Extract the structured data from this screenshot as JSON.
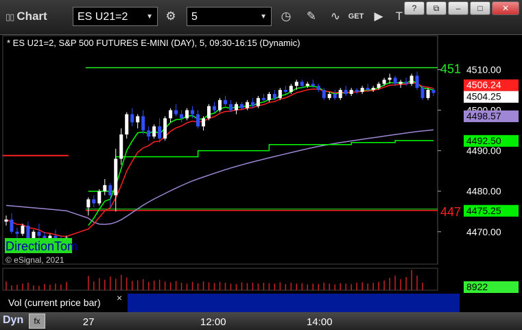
{
  "toolbar": {
    "title": "Chart",
    "symbol": "ES U21=2",
    "interval": "5",
    "window_controls": [
      "?",
      "⧉",
      "–",
      "□",
      "✕"
    ]
  },
  "chart_header": "* ES U21=2, S&P 500 FUTURES E-MINI (DAY), 5, 09:30-16:15 (Dynamic)",
  "watermark": {
    "logo_text": "DirectionTom",
    "copyright": "© eSignal, 2021"
  },
  "status": {
    "dyn_label": "Dyn"
  },
  "volume_panel": {
    "label": "Vol (current price bar)",
    "value_tag": "8922",
    "close_icon": "×"
  },
  "colors": {
    "candle_up": "#ffffff",
    "candle_down": "#3050ff",
    "ema_green": "#00ff00",
    "ema_red": "#ff2020",
    "vwap": "#9f87d6",
    "ref_red": "#ff2020",
    "ref_green": "#22ee22",
    "vol_bar": "#cc2222",
    "vol_tag": "#33ee33"
  },
  "chart_data": {
    "type": "candlestick",
    "y_axis": {
      "ticks": [
        4510.0,
        4500.0,
        4490.0,
        4480.0,
        4470.0
      ],
      "range": [
        4462,
        4515
      ]
    },
    "x_axis": {
      "labels": [
        "27",
        "12:00",
        "14:00"
      ]
    },
    "price_tags": [
      {
        "label": "4506.24",
        "value": 4506.24,
        "bg": "#ff2020",
        "fg": "#ffffff"
      },
      {
        "label": "4504.25",
        "value": 4504.25,
        "bg": "#ffffff",
        "fg": "#000000"
      },
      {
        "label": "4498.57",
        "value": 4498.57,
        "bg": "#9f87d6",
        "fg": "#000000"
      },
      {
        "label": "4492.50",
        "value": 4492.5,
        "bg": "#00ee00",
        "fg": "#000000"
      },
      {
        "label": "4475.25",
        "value": 4475.25,
        "bg": "#00ee00",
        "fg": "#000000"
      }
    ],
    "ref_lines": [
      {
        "label": "451",
        "value": 4510.5,
        "color": "#22ee22"
      },
      {
        "label": "447",
        "value": 4475.25,
        "color": "#ff2020"
      }
    ],
    "prev_day_red_level": 4488.8,
    "candles": [
      [
        4472.5,
        4474.0,
        4471.5,
        4473.0
      ],
      [
        4473.0,
        4474.5,
        4469.5,
        4470.0
      ],
      [
        4470.0,
        4471.0,
        4468.0,
        4469.5
      ],
      [
        4469.5,
        4472.0,
        4469.0,
        4471.5
      ],
      [
        4471.5,
        4472.5,
        4467.5,
        4468.0
      ],
      [
        4468.0,
        4470.5,
        4467.0,
        4470.0
      ],
      [
        4470.0,
        4472.0,
        4468.5,
        4469.0
      ],
      [
        4469.0,
        4470.0,
        4466.5,
        4467.0
      ],
      [
        4467.0,
        4469.5,
        4466.0,
        4469.0
      ],
      [
        4469.0,
        4470.5,
        4467.5,
        4468.0
      ],
      [
        4468.0,
        4469.0,
        4466.5,
        4467.5
      ],
      [
        4467.5,
        4469.0,
        4466.5,
        4468.5
      ],
      [
        4476.0,
        4478.5,
        4474.0,
        4478.0
      ],
      [
        4478.0,
        4479.0,
        4476.0,
        4477.0
      ],
      [
        4477.0,
        4480.5,
        4476.5,
        4480.0
      ],
      [
        4480.0,
        4483.0,
        4479.0,
        4481.5
      ],
      [
        4481.5,
        4482.0,
        4476.0,
        4479.0
      ],
      [
        4479.0,
        4490.5,
        4475.0,
        4488.0
      ],
      [
        4488.0,
        4495.5,
        4486.5,
        4494.0
      ],
      [
        4494.0,
        4499.5,
        4493.0,
        4499.0
      ],
      [
        4499.0,
        4500.5,
        4496.0,
        4497.0
      ],
      [
        4497.0,
        4499.0,
        4495.5,
        4498.5
      ],
      [
        4498.5,
        4500.0,
        4494.0,
        4495.0
      ],
      [
        4495.0,
        4496.0,
        4492.5,
        4493.5
      ],
      [
        4493.5,
        4496.5,
        4493.0,
        4496.0
      ],
      [
        4496.0,
        4498.0,
        4492.0,
        4493.0
      ],
      [
        4493.0,
        4498.5,
        4492.5,
        4498.0
      ],
      [
        4498.0,
        4500.5,
        4497.0,
        4500.0
      ],
      [
        4500.0,
        4501.5,
        4498.5,
        4499.0
      ],
      [
        4499.0,
        4500.0,
        4497.0,
        4498.0
      ],
      [
        4498.0,
        4500.5,
        4497.5,
        4500.0
      ],
      [
        4500.0,
        4501.0,
        4498.0,
        4499.0
      ],
      [
        4499.0,
        4500.0,
        4495.5,
        4496.0
      ],
      [
        4496.0,
        4498.5,
        4495.0,
        4498.0
      ],
      [
        4498.0,
        4501.5,
        4497.5,
        4501.0
      ],
      [
        4501.0,
        4502.0,
        4499.5,
        4500.0
      ],
      [
        4500.0,
        4503.0,
        4499.5,
        4502.5
      ],
      [
        4502.5,
        4503.5,
        4501.0,
        4501.5
      ],
      [
        4501.5,
        4502.5,
        4499.5,
        4500.0
      ],
      [
        4500.0,
        4502.0,
        4499.0,
        4501.5
      ],
      [
        4501.5,
        4502.0,
        4500.0,
        4500.5
      ],
      [
        4500.5,
        4502.5,
        4500.0,
        4502.0
      ],
      [
        4502.0,
        4503.0,
        4500.5,
        4501.0
      ],
      [
        4501.0,
        4503.5,
        4500.5,
        4503.0
      ],
      [
        4503.0,
        4504.0,
        4502.0,
        4502.5
      ],
      [
        4502.5,
        4504.5,
        4502.0,
        4504.0
      ],
      [
        4504.0,
        4505.0,
        4502.5,
        4503.0
      ],
      [
        4503.0,
        4505.5,
        4502.5,
        4505.0
      ],
      [
        4505.0,
        4506.0,
        4504.0,
        4504.5
      ],
      [
        4504.5,
        4506.5,
        4504.0,
        4506.0
      ],
      [
        4506.0,
        4507.5,
        4505.0,
        4507.0
      ],
      [
        4507.0,
        4507.5,
        4505.5,
        4506.0
      ],
      [
        4506.0,
        4507.0,
        4505.5,
        4506.5
      ],
      [
        4506.5,
        4507.5,
        4505.5,
        4506.0
      ],
      [
        4506.0,
        4506.5,
        4504.5,
        4505.0
      ],
      [
        4505.0,
        4505.5,
        4502.5,
        4503.0
      ],
      [
        4503.0,
        4504.5,
        4502.5,
        4504.0
      ],
      [
        4504.0,
        4505.0,
        4502.5,
        4503.0
      ],
      [
        4503.0,
        4505.5,
        4502.5,
        4505.0
      ],
      [
        4505.0,
        4506.0,
        4503.5,
        4504.0
      ],
      [
        4504.0,
        4505.5,
        4503.5,
        4505.0
      ],
      [
        4505.0,
        4505.5,
        4504.0,
        4504.5
      ],
      [
        4504.5,
        4506.0,
        4504.0,
        4505.5
      ],
      [
        4505.5,
        4506.5,
        4504.5,
        4505.0
      ],
      [
        4505.0,
        4506.0,
        4504.5,
        4505.5
      ],
      [
        4505.5,
        4507.0,
        4505.0,
        4506.5
      ],
      [
        4506.5,
        4508.0,
        4506.0,
        4507.5
      ],
      [
        4507.5,
        4509.0,
        4506.5,
        4508.0
      ],
      [
        4508.0,
        4508.5,
        4506.0,
        4506.5
      ],
      [
        4506.5,
        4507.5,
        4505.5,
        4507.0
      ],
      [
        4507.0,
        4508.0,
        4506.0,
        4506.5
      ],
      [
        4506.5,
        4509.0,
        4506.0,
        4508.5
      ],
      [
        4508.5,
        4509.5,
        4505.0,
        4505.5
      ],
      [
        4505.5,
        4506.0,
        4502.5,
        4503.0
      ],
      [
        4503.0,
        4505.5,
        4502.5,
        4505.0
      ],
      [
        4505.0,
        4505.5,
        4503.5,
        4504.25
      ]
    ],
    "volume": [
      40,
      22,
      25,
      30,
      35,
      22,
      20,
      28,
      25,
      30,
      26,
      38,
      65,
      40,
      55,
      48,
      62,
      52,
      70,
      58,
      42,
      45,
      50,
      38,
      44,
      48,
      40,
      36,
      42,
      34,
      30,
      38,
      32,
      40,
      36,
      33,
      38,
      34,
      30,
      28,
      36,
      32,
      35,
      30,
      34,
      32,
      30,
      36,
      28,
      34,
      30,
      32,
      26,
      30,
      28,
      34,
      30,
      26,
      32,
      30,
      28,
      34,
      36,
      30,
      34,
      38,
      44,
      56,
      66,
      50,
      60,
      92,
      66,
      34
    ],
    "vol_range": [
      0,
      100
    ]
  }
}
